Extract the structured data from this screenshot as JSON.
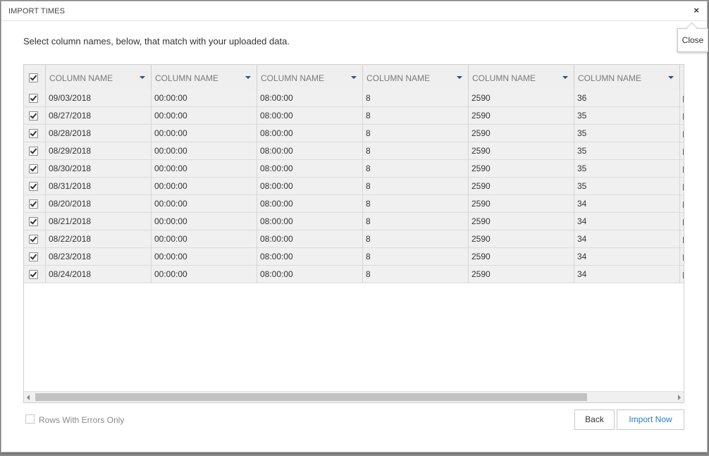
{
  "dialog": {
    "title": "IMPORT TIMES",
    "close_glyph": "×",
    "close_tooltip": "Close",
    "instructions": "Select column names, below, that match with your uploaded data."
  },
  "grid": {
    "header_checked": true,
    "columns": [
      {
        "label": "COLUMN NAME"
      },
      {
        "label": "COLUMN NAME"
      },
      {
        "label": "COLUMN NAME"
      },
      {
        "label": "COLUMN NAME"
      },
      {
        "label": "COLUMN NAME"
      },
      {
        "label": "COLUMN NAME"
      }
    ],
    "rows": [
      {
        "checked": true,
        "cells": [
          "09/03/2018",
          "00:00:00",
          "08:00:00",
          "8",
          "2590",
          "36"
        ]
      },
      {
        "checked": true,
        "cells": [
          "08/27/2018",
          "00:00:00",
          "08:00:00",
          "8",
          "2590",
          "35"
        ]
      },
      {
        "checked": true,
        "cells": [
          "08/28/2018",
          "00:00:00",
          "08:00:00",
          "8",
          "2590",
          "35"
        ]
      },
      {
        "checked": true,
        "cells": [
          "08/29/2018",
          "00:00:00",
          "08:00:00",
          "8",
          "2590",
          "35"
        ]
      },
      {
        "checked": true,
        "cells": [
          "08/30/2018",
          "00:00:00",
          "08:00:00",
          "8",
          "2590",
          "35"
        ]
      },
      {
        "checked": true,
        "cells": [
          "08/31/2018",
          "00:00:00",
          "08:00:00",
          "8",
          "2590",
          "35"
        ]
      },
      {
        "checked": true,
        "cells": [
          "08/20/2018",
          "00:00:00",
          "08:00:00",
          "8",
          "2590",
          "34"
        ]
      },
      {
        "checked": true,
        "cells": [
          "08/21/2018",
          "00:00:00",
          "08:00:00",
          "8",
          "2590",
          "34"
        ]
      },
      {
        "checked": true,
        "cells": [
          "08/22/2018",
          "00:00:00",
          "08:00:00",
          "8",
          "2590",
          "34"
        ]
      },
      {
        "checked": true,
        "cells": [
          "08/23/2018",
          "00:00:00",
          "08:00:00",
          "8",
          "2590",
          "34"
        ]
      },
      {
        "checked": true,
        "cells": [
          "08/24/2018",
          "00:00:00",
          "08:00:00",
          "8",
          "2590",
          "34"
        ]
      }
    ]
  },
  "footer": {
    "rows_with_errors_label": "Rows With Errors Only",
    "rows_with_errors_checked": false,
    "back_label": "Back",
    "import_label": "Import Now"
  },
  "colors": {
    "accent": "#2b7bc0",
    "row_bg": "#f0f0f0",
    "header_bg": "#efefef"
  }
}
